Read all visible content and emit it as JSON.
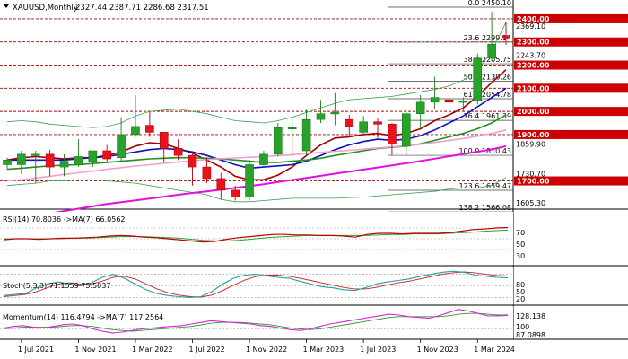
{
  "header": {
    "symbol": "XAUUSD,Monthly",
    "ohlc": "2327.44 2387.71 2286.68 2317.51"
  },
  "fib": [
    {
      "label": "0.0 2450.10",
      "value": 2450.1
    },
    {
      "label": "23.6 2299.14",
      "value": 2299.14
    },
    {
      "label": "38.2 2205.75",
      "value": 2205.75
    },
    {
      "label": "50.0 2130.26",
      "value": 2130.26
    },
    {
      "label": "61.8 2054.78",
      "value": 2054.78
    },
    {
      "label": "76.4 1961.39",
      "value": 1961.39
    },
    {
      "label": "100.0 1810.43",
      "value": 1810.43
    },
    {
      "label": "123.6 1659.47",
      "value": 1659.47
    },
    {
      "label": "138.2 1566.08",
      "value": 1566.08
    }
  ],
  "levels": [
    {
      "label": "2400.00",
      "value": 2400
    },
    {
      "label": "2300.00",
      "value": 2300
    },
    {
      "label": "2200.00",
      "value": 2200
    },
    {
      "label": "2100.00",
      "value": 2100
    },
    {
      "label": "2000.00",
      "value": 2000
    },
    {
      "label": "1900.00",
      "value": 1900
    },
    {
      "label": "1700.00",
      "value": 1700
    }
  ],
  "price_axis_labels": [
    {
      "label": "2369.10",
      "value": 2369.1
    },
    {
      "label": "2243.70",
      "value": 2243.7
    },
    {
      "label": "1859.90",
      "value": 1859.9
    },
    {
      "label": "1730.70",
      "value": 1730.7
    },
    {
      "label": "1605.30",
      "value": 1605.3
    }
  ],
  "panels": {
    "rsi": {
      "label": "RSI(14) 70.8036 ->MA(7) 66.0562",
      "ticks": [
        "70",
        "50",
        "30"
      ]
    },
    "stoch": {
      "label": "Stoch(5,3,3) 71.1559 75.5037",
      "ticks": [
        "80",
        "50",
        "20"
      ]
    },
    "momentum": {
      "label": "Momentum(14) 116.4794 ->MA(7) 117.2564",
      "ticks": [
        "128.138",
        "100",
        "87.0898"
      ]
    }
  },
  "x_axis": {
    "labels": [
      "1 Jul 2021",
      "1 Nov 2021",
      "1 Mar 2022",
      "1 Jul 2022",
      "1 Nov 2022",
      "1 Mar 2023",
      "1 Jul 2023",
      "1 Nov 2023",
      "1 Mar 2024"
    ]
  },
  "colors": {
    "bull": "#27a22a",
    "bear": "#e8141a",
    "level_line": "#b00000",
    "level_tag": "#cc0000",
    "ma_red": "#a00000",
    "ma_blue": "#1010c0",
    "ma_green": "#209020",
    "ma_pink": "#f0a0d0",
    "ma_magenta": "#e010e0",
    "bollinger": "#3aa050",
    "rsi_line": "#c00000",
    "rsi_ma": "#30a030",
    "stoch_main": "#20a0a0",
    "stoch_signal": "#d02020",
    "mom_line": "#e020e0",
    "mom_ma": "#20a020"
  },
  "chart_data": {
    "type": "candlestick",
    "symbol": "XAUUSD",
    "timeframe": "Monthly",
    "ylim": [
      1560,
      2470
    ],
    "months": [
      "2021-06",
      "2021-07",
      "2021-08",
      "2021-09",
      "2021-10",
      "2021-11",
      "2021-12",
      "2022-01",
      "2022-02",
      "2022-03",
      "2022-04",
      "2022-05",
      "2022-06",
      "2022-07",
      "2022-08",
      "2022-09",
      "2022-10",
      "2022-11",
      "2022-12",
      "2023-01",
      "2023-02",
      "2023-03",
      "2023-04",
      "2023-05",
      "2023-06",
      "2023-07",
      "2023-08",
      "2023-09",
      "2023-10",
      "2023-11",
      "2023-12",
      "2024-01",
      "2024-02",
      "2024-03",
      "2024-04",
      "2024-05"
    ],
    "candles": [
      {
        "o": 1770,
        "h": 1800,
        "l": 1750,
        "c": 1790
      },
      {
        "o": 1770,
        "h": 1830,
        "l": 1730,
        "c": 1815
      },
      {
        "o": 1815,
        "h": 1830,
        "l": 1690,
        "c": 1815
      },
      {
        "o": 1815,
        "h": 1835,
        "l": 1720,
        "c": 1760
      },
      {
        "o": 1760,
        "h": 1815,
        "l": 1720,
        "c": 1785
      },
      {
        "o": 1770,
        "h": 1880,
        "l": 1760,
        "c": 1805
      },
      {
        "o": 1785,
        "h": 1830,
        "l": 1760,
        "c": 1830
      },
      {
        "o": 1830,
        "h": 1855,
        "l": 1780,
        "c": 1795
      },
      {
        "o": 1800,
        "h": 1975,
        "l": 1780,
        "c": 1900
      },
      {
        "o": 1900,
        "h": 2070,
        "l": 1890,
        "c": 1935
      },
      {
        "o": 1940,
        "h": 2000,
        "l": 1890,
        "c": 1910
      },
      {
        "o": 1910,
        "h": 1910,
        "l": 1780,
        "c": 1840
      },
      {
        "o": 1840,
        "h": 1880,
        "l": 1790,
        "c": 1810
      },
      {
        "o": 1810,
        "h": 1815,
        "l": 1680,
        "c": 1760
      },
      {
        "o": 1760,
        "h": 1800,
        "l": 1690,
        "c": 1710
      },
      {
        "o": 1710,
        "h": 1735,
        "l": 1620,
        "c": 1660
      },
      {
        "o": 1660,
        "h": 1680,
        "l": 1615,
        "c": 1630
      },
      {
        "o": 1630,
        "h": 1790,
        "l": 1615,
        "c": 1770
      },
      {
        "o": 1770,
        "h": 1830,
        "l": 1765,
        "c": 1815
      },
      {
        "o": 1815,
        "h": 1950,
        "l": 1805,
        "c": 1930
      },
      {
        "o": 1930,
        "h": 1960,
        "l": 1805,
        "c": 1930
      },
      {
        "o": 1830,
        "h": 2010,
        "l": 1810,
        "c": 1965
      },
      {
        "o": 1965,
        "h": 2050,
        "l": 1950,
        "c": 1990
      },
      {
        "o": 1990,
        "h": 2080,
        "l": 1940,
        "c": 1995
      },
      {
        "o": 1965,
        "h": 1985,
        "l": 1890,
        "c": 1935
      },
      {
        "o": 1910,
        "h": 1980,
        "l": 1900,
        "c": 1955
      },
      {
        "o": 1955,
        "h": 1970,
        "l": 1885,
        "c": 1945
      },
      {
        "o": 1945,
        "h": 1950,
        "l": 1810,
        "c": 1860
      },
      {
        "o": 1850,
        "h": 2010,
        "l": 1810,
        "c": 1990
      },
      {
        "o": 1990,
        "h": 2070,
        "l": 1930,
        "c": 2040
      },
      {
        "o": 2040,
        "h": 2150,
        "l": 2010,
        "c": 2060
      },
      {
        "o": 2050,
        "h": 2080,
        "l": 2000,
        "c": 2040
      },
      {
        "o": 2040,
        "h": 2060,
        "l": 2000,
        "c": 2045
      },
      {
        "o": 2045,
        "h": 2250,
        "l": 2030,
        "c": 2230
      },
      {
        "o": 2230,
        "h": 2430,
        "l": 2220,
        "c": 2290
      },
      {
        "o": 2327.44,
        "h": 2387.71,
        "l": 2286.68,
        "c": 2317.51
      }
    ],
    "moving_averages": [
      {
        "color": "ma_red",
        "values": [
          1790,
          1800,
          1805,
          1800,
          1795,
          1800,
          1800,
          1810,
          1825,
          1850,
          1865,
          1860,
          1840,
          1820,
          1790,
          1760,
          1720,
          1705,
          1705,
          1725,
          1760,
          1810,
          1855,
          1885,
          1890,
          1900,
          1905,
          1895,
          1905,
          1925,
          1960,
          1985,
          2015,
          2065,
          2125,
          2180
        ]
      },
      {
        "color": "ma_blue",
        "values": [
          1790,
          1790,
          1790,
          1790,
          1790,
          1795,
          1800,
          1805,
          1815,
          1825,
          1835,
          1840,
          1835,
          1825,
          1810,
          1790,
          1770,
          1755,
          1760,
          1765,
          1770,
          1785,
          1810,
          1835,
          1855,
          1870,
          1880,
          1875,
          1880,
          1895,
          1920,
          1950,
          1980,
          2020,
          2060,
          2100
        ]
      },
      {
        "color": "ma_green",
        "values": [
          1750,
          1755,
          1760,
          1765,
          1768,
          1770,
          1775,
          1780,
          1785,
          1790,
          1795,
          1798,
          1800,
          1800,
          1798,
          1795,
          1790,
          1785,
          1780,
          1780,
          1785,
          1790,
          1798,
          1810,
          1820,
          1830,
          1840,
          1845,
          1850,
          1860,
          1875,
          1890,
          1905,
          1925,
          1950,
          1985
        ]
      },
      {
        "color": "ma_pink",
        "values": [
          1700,
          1705,
          1712,
          1720,
          1728,
          1735,
          1742,
          1750,
          1757,
          1764,
          1770,
          1776,
          1782,
          1787,
          1792,
          1796,
          1799,
          1802,
          1805,
          1809,
          1813,
          1818,
          1823,
          1828,
          1832,
          1837,
          1842,
          1847,
          1852,
          1858,
          1866,
          1874,
          1883,
          1893,
          1905,
          1920
        ]
      },
      {
        "color": "ma_magenta",
        "values": [
          1530,
          1540,
          1550,
          1560,
          1570,
          1580,
          1590,
          1600,
          1608,
          1616,
          1624,
          1632,
          1640,
          1648,
          1655,
          1662,
          1670,
          1678,
          1686,
          1695,
          1704,
          1713,
          1722,
          1731,
          1740,
          1749,
          1758,
          1767,
          1776,
          1786,
          1796,
          1806,
          1816,
          1826,
          1836,
          1850
        ]
      }
    ],
    "bollinger_bands": {
      "color": "bollinger",
      "upper": [
        1955,
        1960,
        1955,
        1945,
        1940,
        1935,
        1930,
        1935,
        1950,
        1980,
        2000,
        2005,
        2010,
        2000,
        1990,
        1975,
        1960,
        1955,
        1950,
        1960,
        1975,
        1995,
        2015,
        2035,
        2050,
        2055,
        2060,
        2065,
        2075,
        2085,
        2095,
        2110,
        2135,
        2175,
        2260,
        2385
      ],
      "lower": [
        1680,
        1685,
        1690,
        1700,
        1700,
        1705,
        1705,
        1700,
        1695,
        1690,
        1680,
        1670,
        1660,
        1650,
        1640,
        1620,
        1610,
        1610,
        1615,
        1620,
        1625,
        1625,
        1625,
        1625,
        1628,
        1630,
        1635,
        1640,
        1645,
        1650,
        1655,
        1665,
        1670,
        1670,
        1680,
        1715
      ]
    },
    "rsi": {
      "ylim": [
        0,
        100
      ],
      "series": [
        48,
        50,
        50,
        49,
        50,
        51,
        51,
        52,
        53,
        55,
        56,
        55,
        53,
        52,
        50,
        48,
        46,
        44,
        45,
        49,
        52,
        54,
        56,
        58,
        58,
        57,
        57,
        56,
        56,
        55,
        53,
        58,
        60,
        60,
        59,
        60,
        60,
        60,
        61,
        64,
        67,
        68,
        70,
        70.8036
      ],
      "ma": [
        50,
        50,
        50,
        50,
        50,
        50,
        51,
        51,
        52,
        53,
        54,
        54,
        54,
        53,
        52,
        51,
        49,
        47,
        46,
        46,
        47,
        49,
        51,
        53,
        54,
        55,
        56,
        56,
        56,
        56,
        56,
        56,
        57,
        58,
        58,
        59,
        59,
        59,
        60,
        61,
        62,
        64,
        65,
        66.0562
      ]
    },
    "stochastic": {
      "ylim": [
        0,
        100
      ],
      "main": [
        25,
        28,
        30,
        45,
        55,
        60,
        55,
        50,
        58,
        72,
        80,
        70,
        55,
        40,
        30,
        25,
        22,
        20,
        22,
        35,
        55,
        70,
        78,
        80,
        76,
        72,
        70,
        62,
        55,
        48,
        45,
        40,
        38,
        45,
        55,
        60,
        64,
        68,
        75,
        80,
        85,
        88,
        85,
        78,
        75,
        72,
        71.1559
      ],
      "signal": [
        22,
        25,
        28,
        35,
        45,
        55,
        58,
        55,
        55,
        62,
        72,
        75,
        68,
        55,
        42,
        32,
        26,
        22,
        21,
        26,
        38,
        52,
        65,
        74,
        78,
        78,
        75,
        70,
        64,
        58,
        52,
        46,
        42,
        42,
        46,
        52,
        58,
        62,
        68,
        74,
        80,
        84,
        86,
        84,
        80,
        77,
        75.5037
      ]
    },
    "momentum": {
      "ylim": [
        87.0898,
        128.138
      ],
      "series": [
        101,
        103,
        104,
        102,
        101,
        103,
        105,
        106,
        104,
        100,
        97,
        95,
        96,
        98,
        100,
        101,
        102,
        103,
        104,
        106,
        108,
        110,
        109,
        108,
        107,
        106,
        104,
        103,
        101,
        99,
        98,
        100,
        103,
        106,
        108,
        110,
        112,
        114,
        116,
        118,
        117,
        115,
        114,
        113,
        116,
        120,
        124,
        122,
        119,
        116,
        116,
        116.4794
      ],
      "ma": [
        100,
        101,
        102,
        102,
        102,
        102,
        103,
        104,
        104,
        103,
        101,
        99,
        98,
        97,
        98,
        99,
        100,
        101,
        102,
        103,
        105,
        107,
        108,
        108,
        108,
        107,
        106,
        105,
        103,
        101,
        100,
        99,
        100,
        102,
        104,
        106,
        108,
        110,
        112,
        114,
        115,
        115,
        115,
        115,
        115,
        116,
        118,
        119,
        119,
        118,
        117,
        117.2564
      ]
    }
  }
}
